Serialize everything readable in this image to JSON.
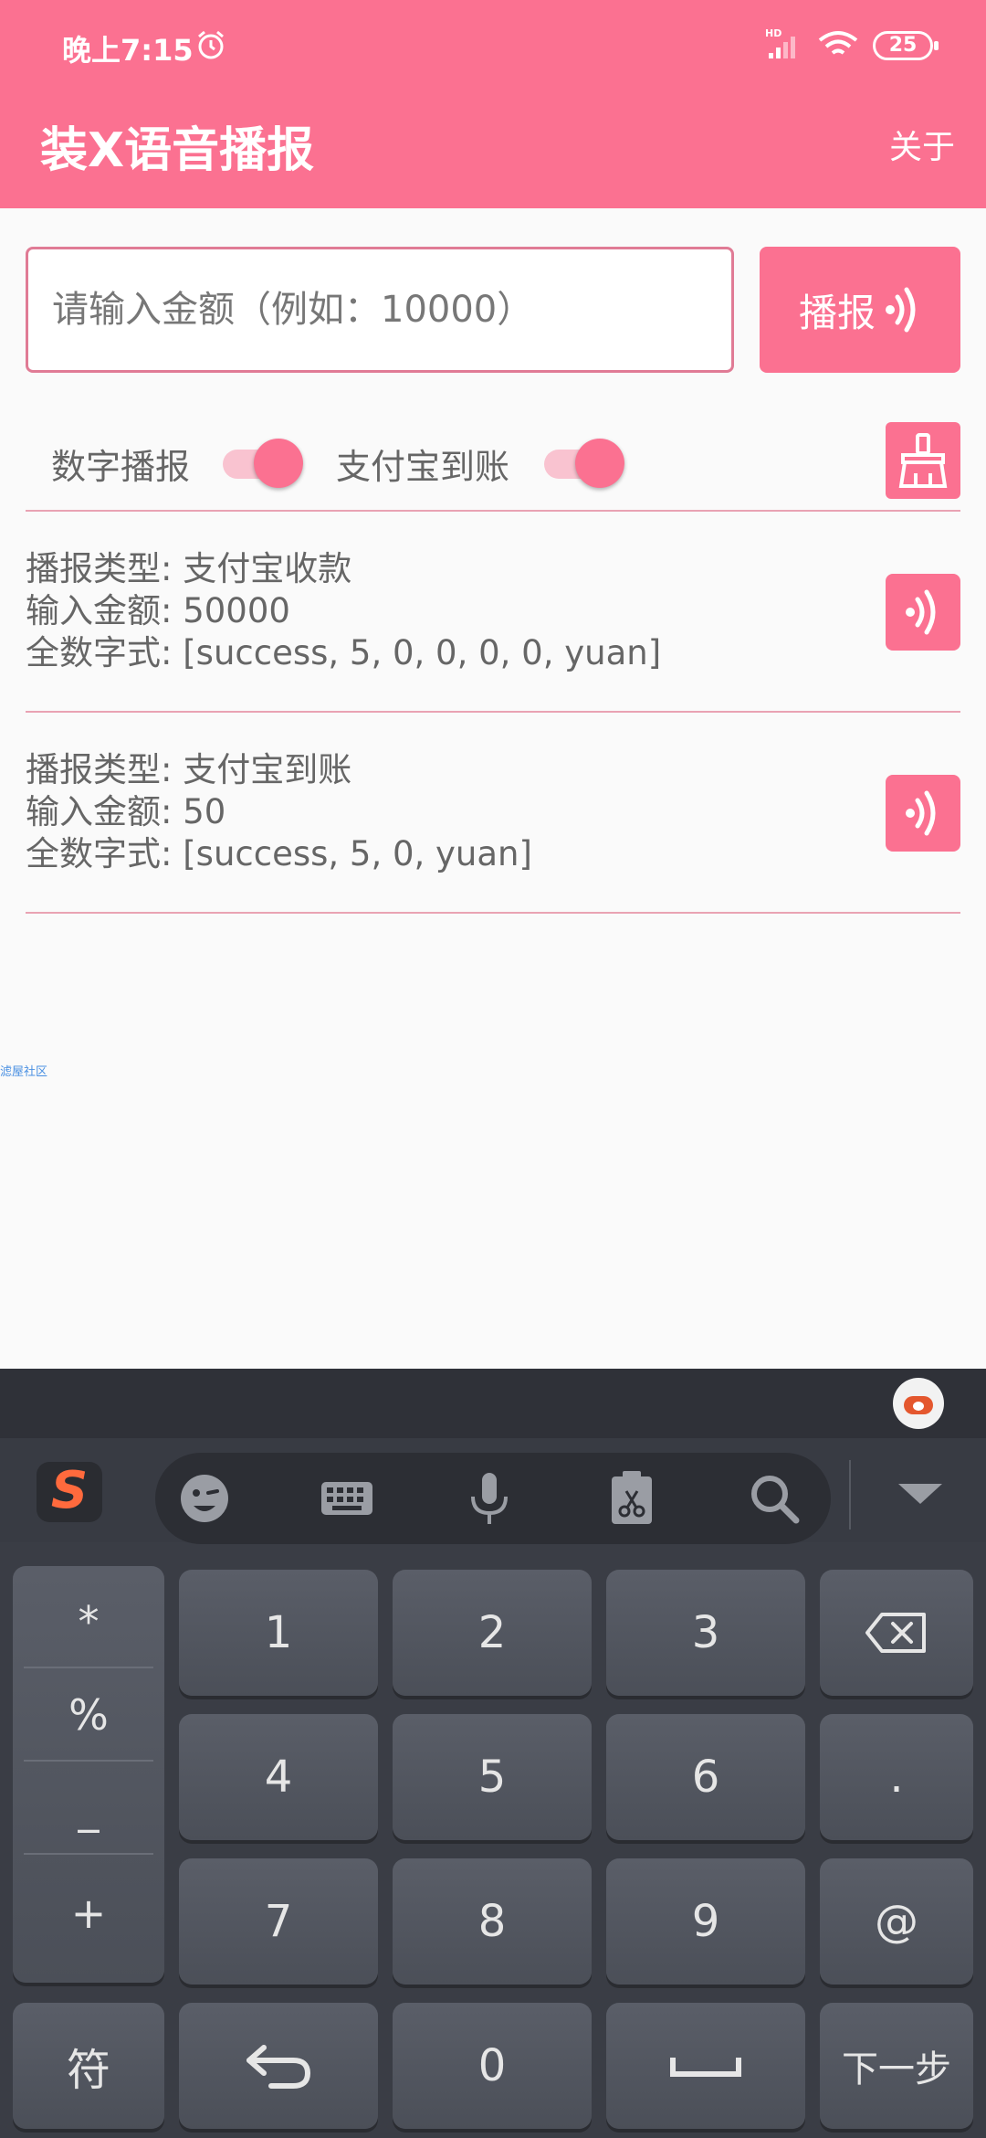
{
  "status_bar": {
    "time": "晚上7:15",
    "battery": "25"
  },
  "app_bar": {
    "title": "装X语音播报",
    "about": "关于"
  },
  "input": {
    "placeholder": "请输入金额（例如：10000）",
    "value": ""
  },
  "play_button": {
    "label": "播报"
  },
  "switches": [
    {
      "label": "数字播报",
      "on": true
    },
    {
      "label": "支付宝到账",
      "on": true
    }
  ],
  "records": [
    {
      "type_line": "播报类型: 支付宝收款",
      "amount_line": "输入金额: 50000",
      "digits_line": "全数字式: [success, 5, 0, 0, 0, 0, yuan]"
    },
    {
      "type_line": "播报类型: 支付宝到账",
      "amount_line": "输入金额: 50",
      "digits_line": "全数字式: [success, 5, 0, yuan]"
    }
  ],
  "watermark": "滤屋社区",
  "keyboard": {
    "logo": "S",
    "tools": [
      "emoji-icon",
      "keyboard-icon",
      "microphone-icon",
      "clipboard-icon",
      "search-icon"
    ],
    "symbols": [
      "*",
      "%",
      "_",
      "+"
    ],
    "keys": {
      "k1": "1",
      "k2": "2",
      "k3": "3",
      "k4": "4",
      "k5": "5",
      "k6": "6",
      "dot": ".",
      "k7": "7",
      "k8": "8",
      "k9": "9",
      "at": "@",
      "fu": "符",
      "k0": "0",
      "next": "下一步"
    }
  },
  "colors": {
    "accent": "#fb7191",
    "keyboard_bg": "#3a3d45"
  }
}
